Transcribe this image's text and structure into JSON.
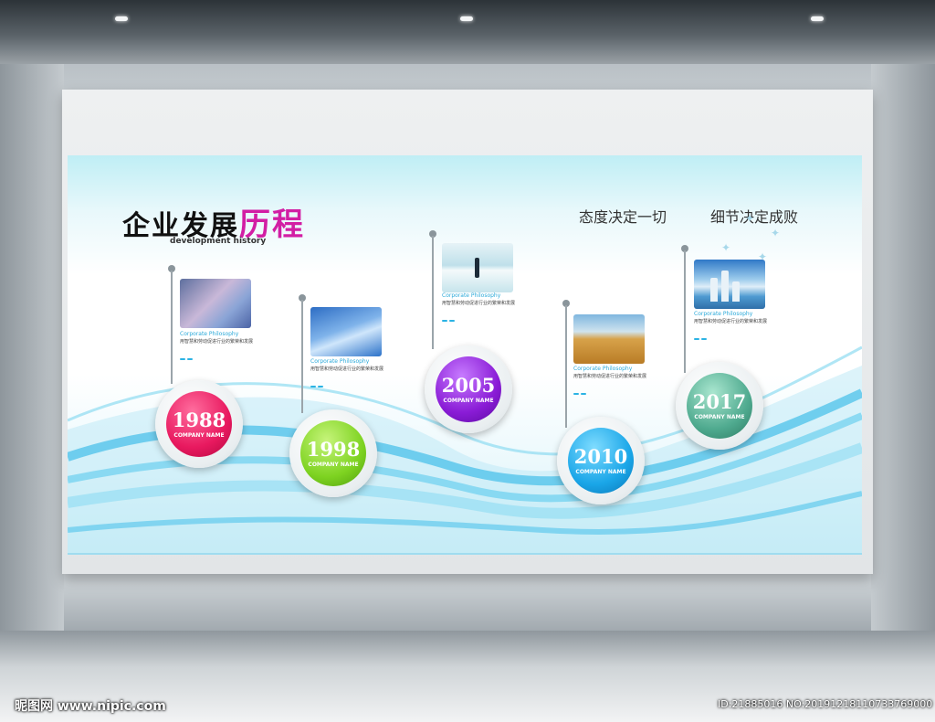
{
  "title": {
    "main": "企业发展",
    "accent": "历程",
    "subtitle": "development history"
  },
  "slogans": [
    "态度决定一切",
    "细节决定成败"
  ],
  "milestones": [
    {
      "year": "1988",
      "company": "COMPANY NAME",
      "color": "#e8195f",
      "heading": "Corporate Philosophy",
      "text": "用智慧和劳动促进行业的繁荣和发展"
    },
    {
      "year": "1998",
      "company": "COMPANY NAME",
      "color": "#7ed321",
      "heading": "Corporate Philosophy",
      "text": "用智慧和劳动促进行业的繁荣和发展"
    },
    {
      "year": "2005",
      "company": "COMPANY NAME",
      "color": "#8a1cd6",
      "heading": "Corporate Philosophy",
      "text": "用智慧和劳动促进行业的繁荣和发展"
    },
    {
      "year": "2010",
      "company": "COMPANY NAME",
      "color": "#1aa6e8",
      "heading": "Corporate Philosophy",
      "text": "用智慧和劳动促进行业的繁荣和发展"
    },
    {
      "year": "2017",
      "company": "COMPANY NAME",
      "color": "#4faa8f",
      "heading": "Corporate Philosophy",
      "text": "用智慧和劳动促进行业的繁荣和发展"
    }
  ],
  "watermark": {
    "site": "昵图网 www.nipic.com",
    "id": "ID:21885016 NO:20191218110733769000"
  },
  "colors": {
    "accent": "#d21ea4",
    "wave": "#29b6e6"
  }
}
